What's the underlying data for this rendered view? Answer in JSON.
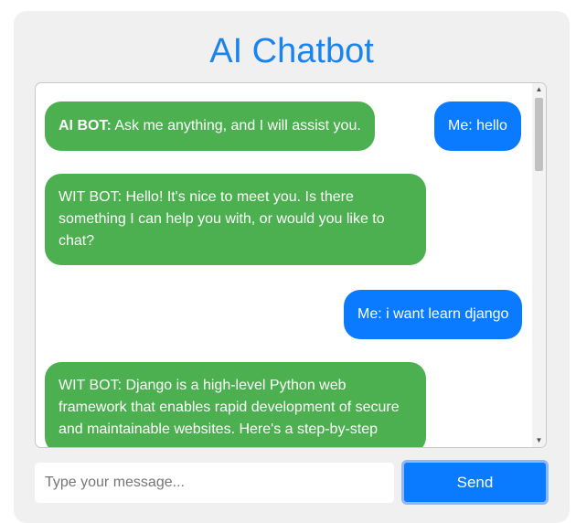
{
  "app": {
    "title": "AI Chatbot"
  },
  "messages": [
    {
      "sender": "bot",
      "prefix": "AI BOT:",
      "text": " Ask me anything, and I will assist you."
    },
    {
      "sender": "me",
      "text": "Me: hello"
    },
    {
      "sender": "bot",
      "text": "WIT BOT: Hello! It's nice to meet you. Is there something I can help you with, or would you like to chat?"
    },
    {
      "sender": "me",
      "text": "Me: i want learn django"
    },
    {
      "sender": "bot",
      "text": "WIT BOT: Django is a high-level Python web framework that enables rapid development of secure and maintainable websites. Here's a step-by-step"
    }
  ],
  "input": {
    "placeholder": "Type your message...",
    "value": ""
  },
  "send_button": {
    "label": "Send"
  },
  "colors": {
    "title": "#1a84ee",
    "bot_bubble": "#4caf50",
    "user_bubble": "#0a7bff"
  },
  "icons": {
    "scroll_up": "triangle-up-icon",
    "scroll_down": "triangle-down-icon"
  }
}
